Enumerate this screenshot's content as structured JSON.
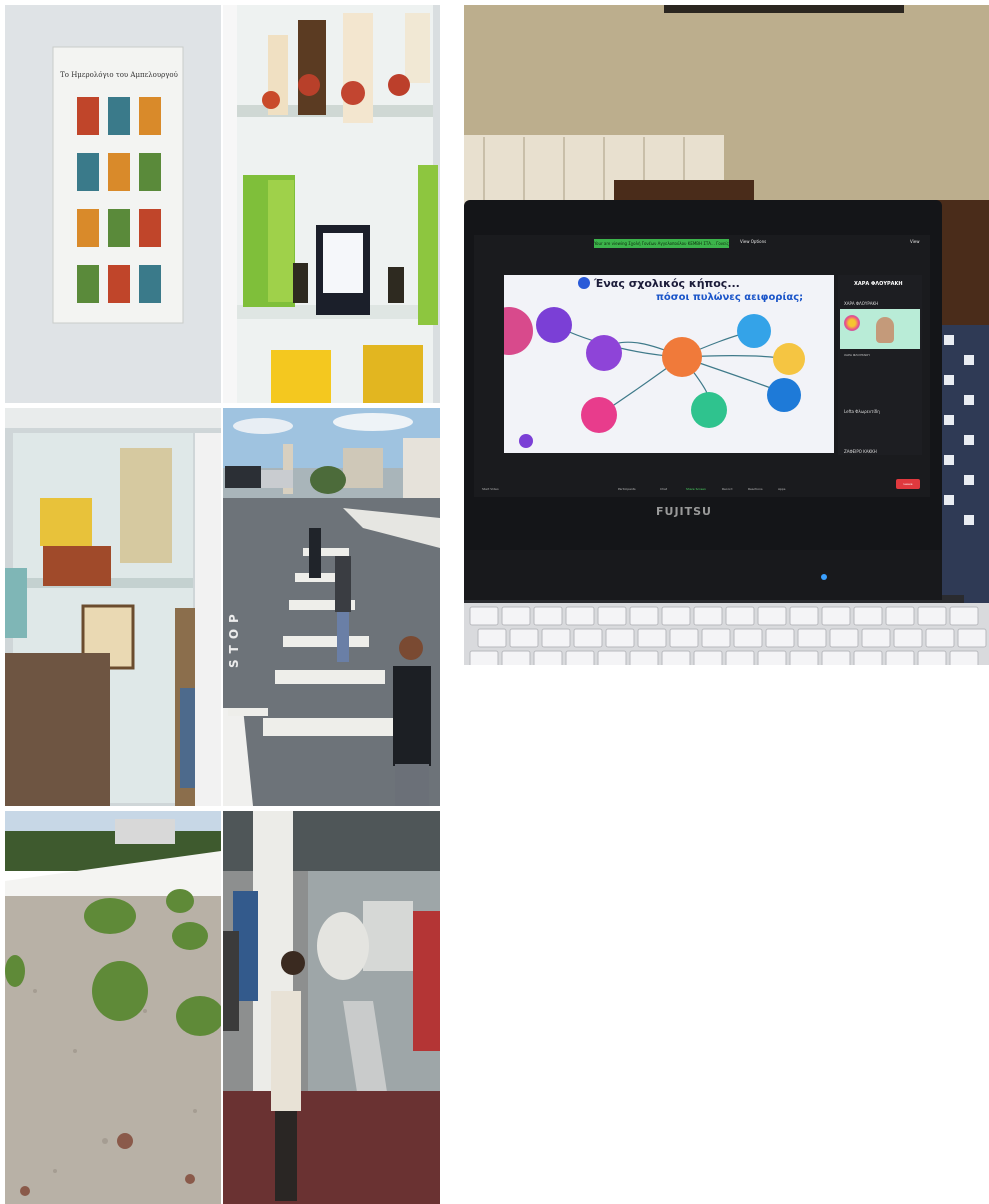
{
  "collage": {
    "photo1": {
      "poster_title": "Το Ημερολόγιο του Αμπελουργού"
    },
    "photo2": {},
    "photo3": {},
    "photo4": {
      "road_marking": "STOP"
    },
    "photo5": {},
    "photo6": {},
    "laptop": {
      "brand": "FUJITSU",
      "meeting_banner": "Your are viewing Σχολή Γονέων Αγγελοπούλου ΚΕΜΒΗ ΣΤΑ... Γονείς",
      "view_options": "View Options",
      "view_button": "View",
      "slide": {
        "title_line1": "Ένας σχολικός κήπος...",
        "title_line2": "πόσοι πυλώνες αειφορίας;"
      },
      "participants": {
        "header": "ΧΑΡΑ ΦΛΟΥΡΑΚΗ",
        "p1": "ΧΑΡΑ ΦΛΟΥΡΑΚΗ",
        "p2": "ΧΑΡΑ ΦΛΟΥΡΑΚΗ",
        "p3": "Lefta Φλωρεντίδη",
        "p4": "ΖΑΦΕΙΡΟ ΚΑΚΚΗ"
      },
      "toolbar": {
        "start_video": "Start Video",
        "participants": "Participants",
        "chat": "Chat",
        "share_screen": "Share Screen",
        "record": "Record",
        "reactions": "Reactions",
        "apps": "Apps",
        "leave": "Leave"
      }
    }
  }
}
